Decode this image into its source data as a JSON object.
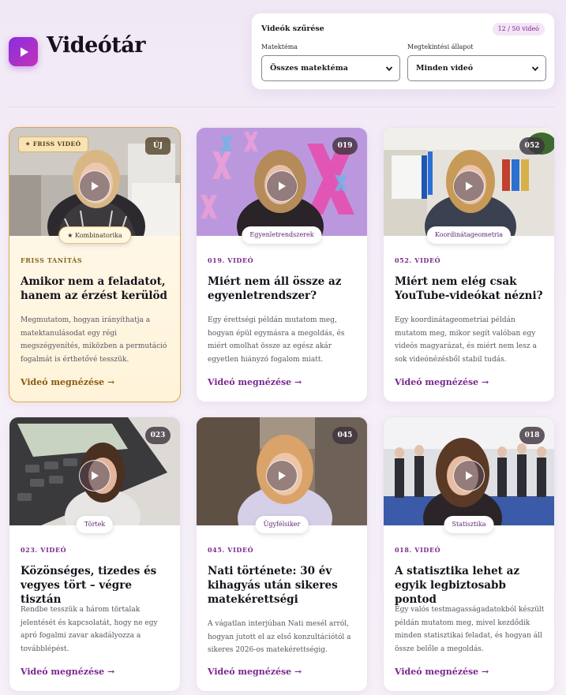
{
  "header": {
    "title": "Videótár",
    "logo_icon": "play-icon"
  },
  "filter": {
    "title": "Videók szűrése",
    "count": "12 / 50 videó",
    "topic_label": "Matektéma",
    "topic_value": "Összes matektéma",
    "status_label": "Megtekintési állapot",
    "status_value": "Minden videó"
  },
  "cards": [
    {
      "featured": true,
      "fresh_badge": "✦ FRISS VIDEÓ",
      "corner_badge": "ÚJ",
      "topic": "★ Kombinatorika",
      "kicker": "FRISS TANÍTÁS",
      "title": "Amikor nem a feladatot, hanem az érzést kerülöd",
      "desc": "Megmutatom, hogyan irányíthatja a matektanulásodat egy régi megszégyenítés, miközben a permutáció fogalmát is érthetővé tesszük.",
      "link": "Videó megnézése →"
    },
    {
      "featured": false,
      "corner_badge": "019",
      "topic": "Egyenletrendszerek",
      "kicker": "019. VIDEÓ",
      "title": "Miért nem áll össze az egyenletrendszer?",
      "desc": "Egy érettségi példán mutatom meg, hogyan épül egymásra a megoldás, és miért omolhat össze az egész akár egyetlen hiányzó fogalom miatt.",
      "link": "Videó megnézése →"
    },
    {
      "featured": false,
      "corner_badge": "052",
      "topic": "Koordinátageometria",
      "kicker": "052. VIDEÓ",
      "title": "Miért nem elég csak YouTube-videókat nézni?",
      "desc": "Egy koordinátageometriai példán mutatom meg, mikor segít valóban egy videós magyarázat, és miért nem lesz a sok videónézésből stabil tudás.",
      "link": "Videó megnézése →"
    },
    {
      "featured": false,
      "corner_badge": "023",
      "topic": "Törtek",
      "kicker": "023. VIDEÓ",
      "title": "Közönséges, tizedes és vegyes tört – végre tisztán",
      "desc": "Rendbe tesszük a három törtalak jelentését és kapcsolatát, hogy ne egy apró fogalmi zavar akadályozza a továbblépést.",
      "link": "Videó megnézése →"
    },
    {
      "featured": false,
      "corner_badge": "045",
      "topic": "Ügyfélsiker",
      "kicker": "045. VIDEÓ",
      "title": "Nati története: 30 év kihagyás után sikeres matekérettségi",
      "desc": "A vágatlan interjúban Nati mesél arról, hogyan jutott el az első konzultációtól a sikeres 2026-os matekérettségig.",
      "link": "Videó megnézése →"
    },
    {
      "featured": false,
      "corner_badge": "018",
      "topic": "Statisztika",
      "kicker": "018. VIDEÓ",
      "title": "A statisztika lehet az egyik legbiztosabb pontod",
      "desc": "Egy valós testmagasságadatokból készült példán mutatom meg, mivel kezdődik minden statisztikai feladat, és hogyan áll össze belőle a megoldás.",
      "link": "Videó megnézése →"
    }
  ],
  "colors": {
    "accent": "#7a2690",
    "featured_border": "#d9a94a",
    "logo_from": "#8a2ee0",
    "logo_to": "#c232b8"
  }
}
